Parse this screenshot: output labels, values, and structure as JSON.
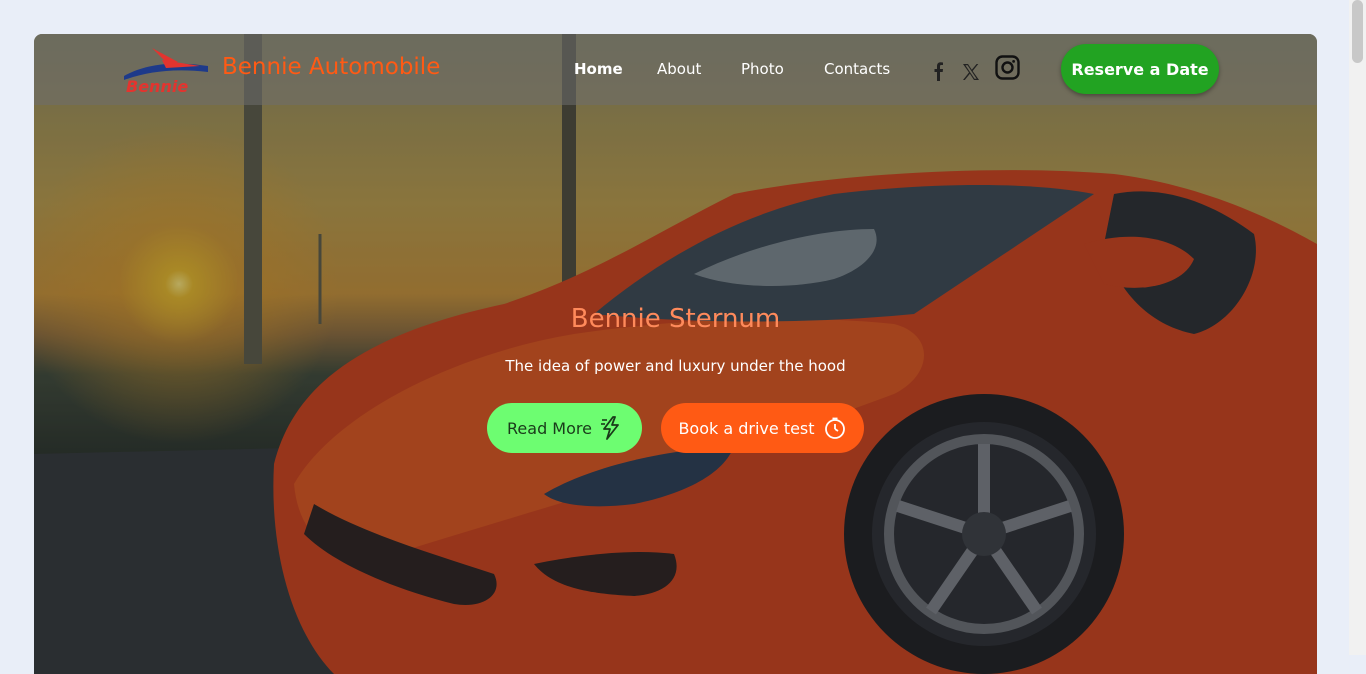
{
  "brand": {
    "name": "Bennie Automobile",
    "logo_text": "Bennie",
    "logo_icon": "bennie-car-logo"
  },
  "nav": {
    "items": [
      {
        "label": "Home",
        "active": true
      },
      {
        "label": "About",
        "active": false
      },
      {
        "label": "Photo",
        "active": false
      },
      {
        "label": "Contacts",
        "active": false
      }
    ],
    "social": [
      "facebook-icon",
      "x-icon",
      "instagram-icon"
    ],
    "cta_label": "Reserve a Date"
  },
  "hero": {
    "title": "Bennie Sternum",
    "subtitle": "The idea of power and luxury under the hood",
    "buttons": [
      {
        "label": "Read More",
        "icon": "lightning-icon"
      },
      {
        "label": "Book a drive test",
        "icon": "stopwatch-icon"
      }
    ]
  },
  "colors": {
    "accent_orange": "#ff5a14",
    "accent_green": "#22a322",
    "light_green": "#6dfd71",
    "page_bg": "#e9eef8"
  }
}
